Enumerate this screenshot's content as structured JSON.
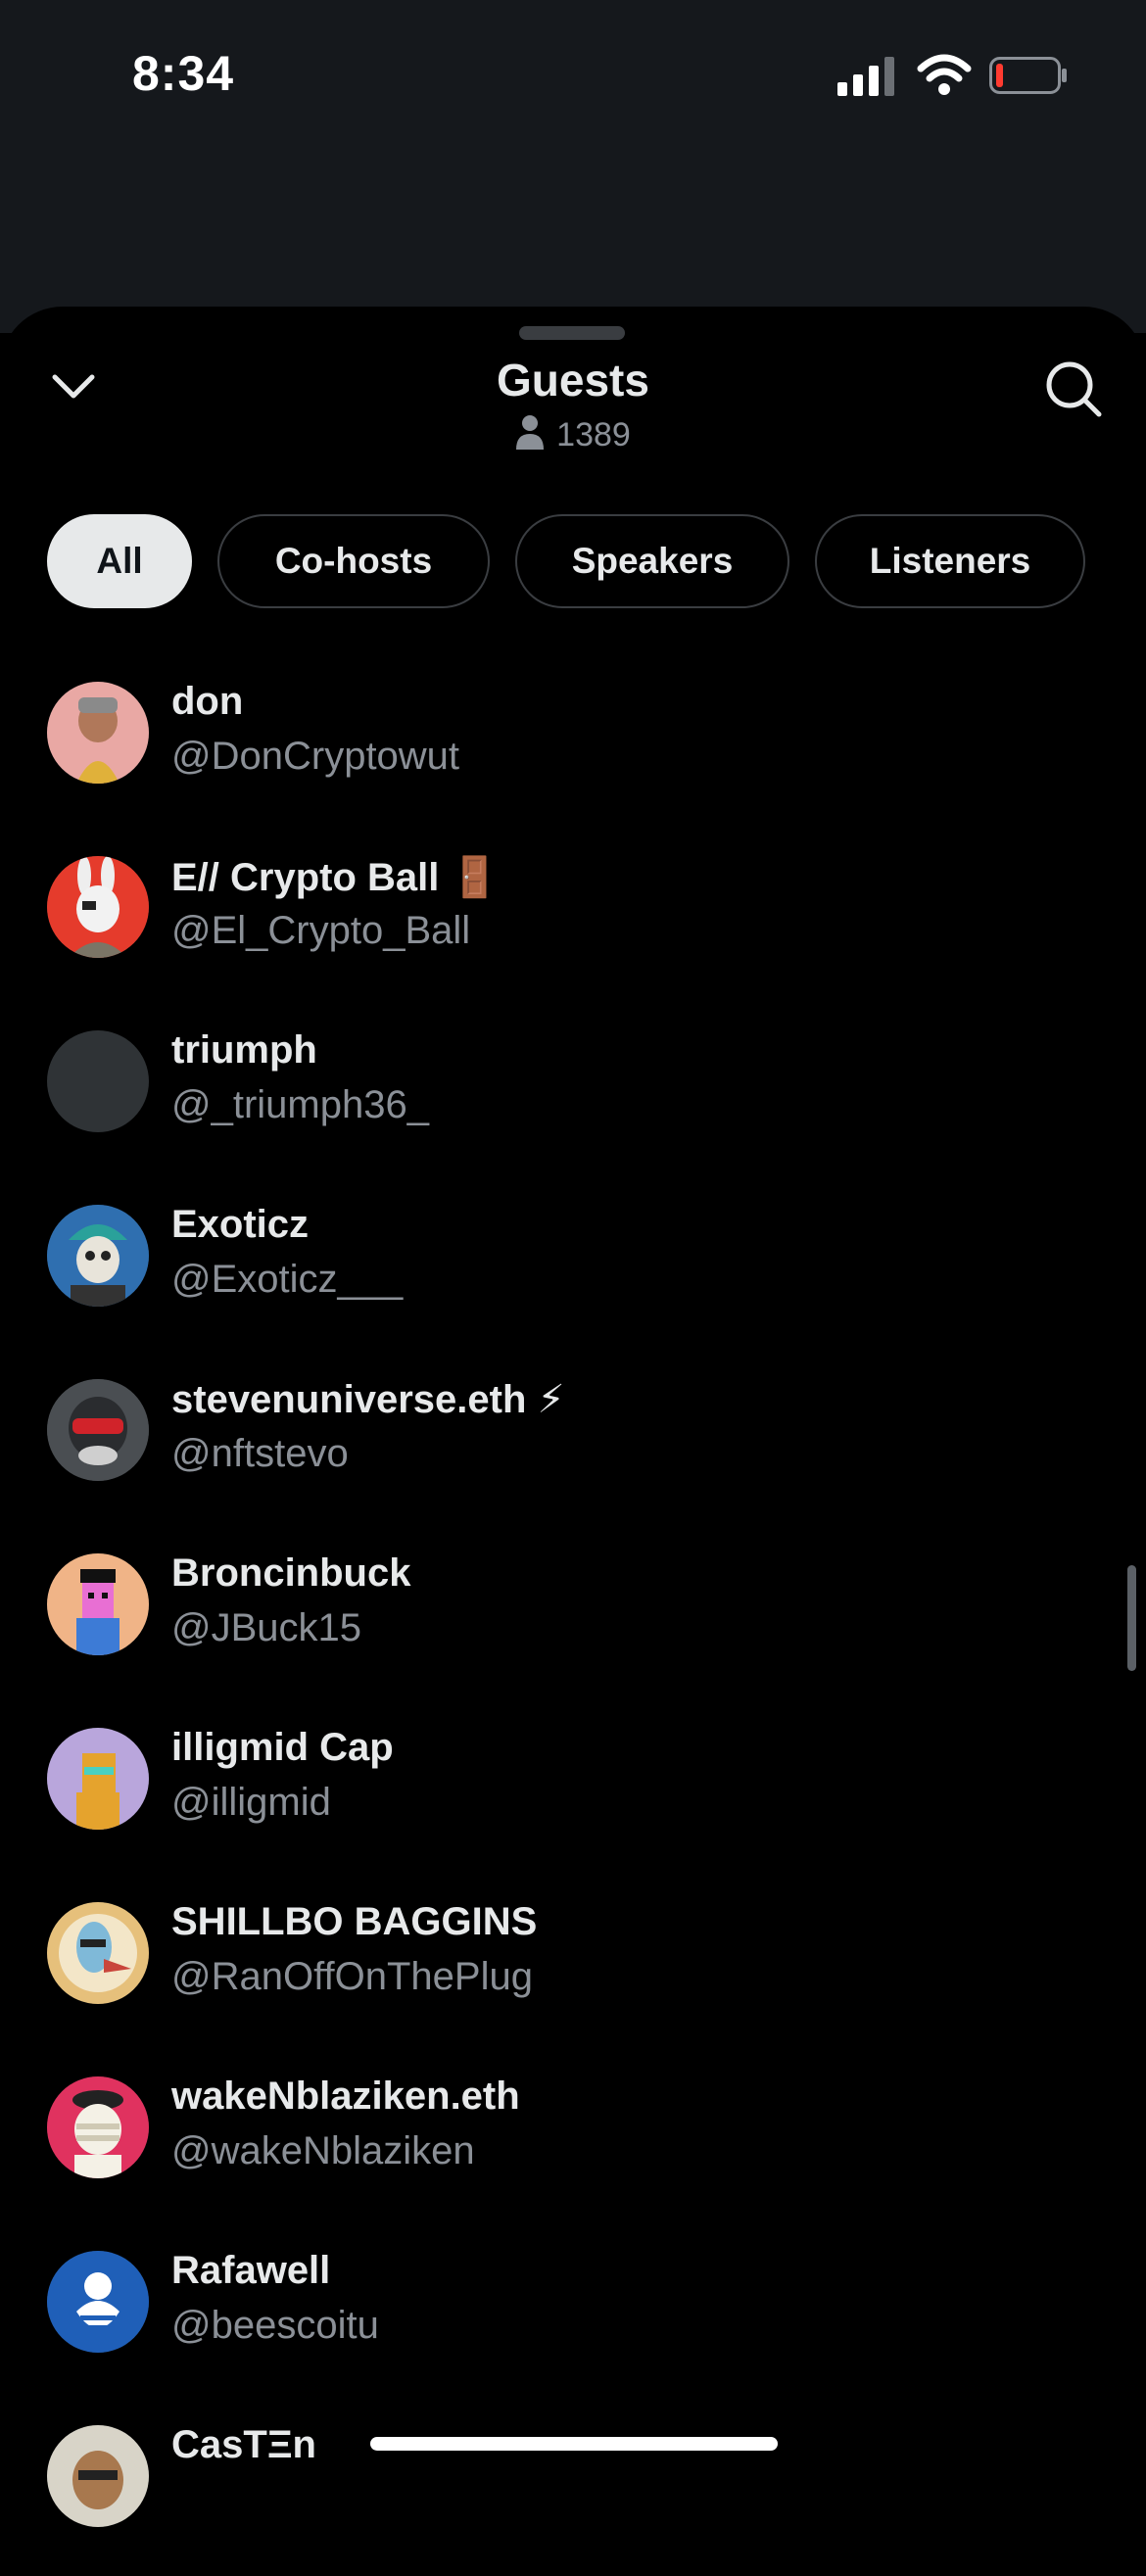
{
  "status_bar": {
    "time": "8:34"
  },
  "sheet": {
    "title": "Guests",
    "count": "1389"
  },
  "tabs": [
    {
      "label": "All",
      "active": true
    },
    {
      "label": "Co-hosts",
      "active": false
    },
    {
      "label": "Speakers",
      "active": false
    },
    {
      "label": "Listeners",
      "active": false
    }
  ],
  "guests": [
    {
      "name": "don",
      "handle": "@DonCryptowut",
      "avatar_color": "#e9a8a4"
    },
    {
      "name": "E// Crypto Ball 🚪",
      "handle": "@El_Crypto_Ball",
      "avatar_color": "#e53b2c"
    },
    {
      "name": "triumph",
      "handle": "@_triumph36_",
      "avatar_color": "#2f3336"
    },
    {
      "name": "Exoticz",
      "handle": "@Exoticz___",
      "avatar_color": "#2f6fb0"
    },
    {
      "name": "stevenuniverse.eth ⚡",
      "handle": "@nftstevo",
      "avatar_color": "#4a4e52"
    },
    {
      "name": "Broncinbuck",
      "handle": "@JBuck15",
      "avatar_color": "#f0b487"
    },
    {
      "name": "illigmid Cap",
      "handle": "@illigmid",
      "avatar_color": "#b9a6dc"
    },
    {
      "name": "SHILLBO BAGGINS",
      "handle": "@RanOffOnThePlug",
      "avatar_color": "#e6c07b"
    },
    {
      "name": "wakeNblaziken.eth",
      "handle": "@wakeNblaziken",
      "avatar_color": "#e0325f"
    },
    {
      "name": "Rafawell",
      "handle": "@beescoitu",
      "avatar_color": "#1f5fb8"
    },
    {
      "name": "CasTΞn",
      "handle": "",
      "avatar_color": "#d8d4c8"
    }
  ],
  "colors": {
    "accent_bg": "#e7e9ea",
    "muted": "#8b9097",
    "bg": "#000000"
  }
}
